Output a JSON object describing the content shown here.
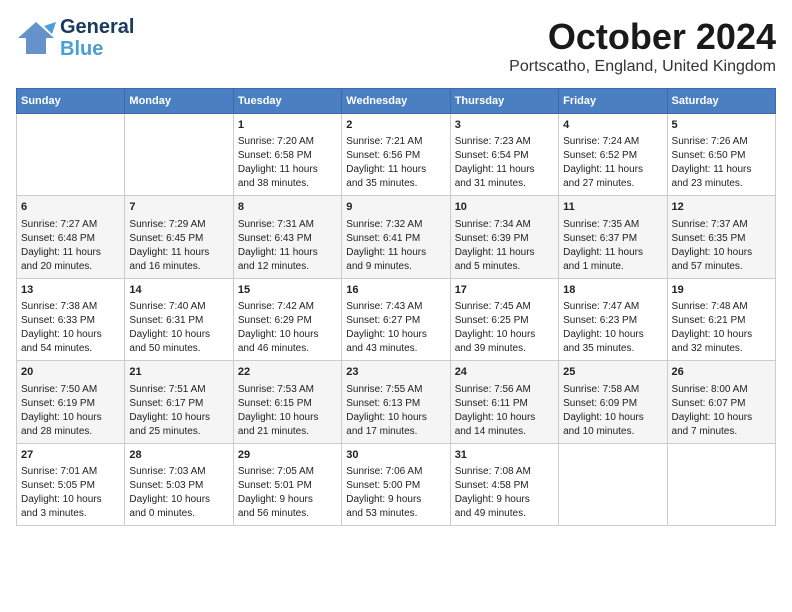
{
  "logo": {
    "line1": "General",
    "line2": "Blue"
  },
  "title": "October 2024",
  "location": "Portscatho, England, United Kingdom",
  "days_of_week": [
    "Sunday",
    "Monday",
    "Tuesday",
    "Wednesday",
    "Thursday",
    "Friday",
    "Saturday"
  ],
  "weeks": [
    [
      {
        "day": "",
        "content": ""
      },
      {
        "day": "",
        "content": ""
      },
      {
        "day": "1",
        "content": "Sunrise: 7:20 AM\nSunset: 6:58 PM\nDaylight: 11 hours\nand 38 minutes."
      },
      {
        "day": "2",
        "content": "Sunrise: 7:21 AM\nSunset: 6:56 PM\nDaylight: 11 hours\nand 35 minutes."
      },
      {
        "day": "3",
        "content": "Sunrise: 7:23 AM\nSunset: 6:54 PM\nDaylight: 11 hours\nand 31 minutes."
      },
      {
        "day": "4",
        "content": "Sunrise: 7:24 AM\nSunset: 6:52 PM\nDaylight: 11 hours\nand 27 minutes."
      },
      {
        "day": "5",
        "content": "Sunrise: 7:26 AM\nSunset: 6:50 PM\nDaylight: 11 hours\nand 23 minutes."
      }
    ],
    [
      {
        "day": "6",
        "content": "Sunrise: 7:27 AM\nSunset: 6:48 PM\nDaylight: 11 hours\nand 20 minutes."
      },
      {
        "day": "7",
        "content": "Sunrise: 7:29 AM\nSunset: 6:45 PM\nDaylight: 11 hours\nand 16 minutes."
      },
      {
        "day": "8",
        "content": "Sunrise: 7:31 AM\nSunset: 6:43 PM\nDaylight: 11 hours\nand 12 minutes."
      },
      {
        "day": "9",
        "content": "Sunrise: 7:32 AM\nSunset: 6:41 PM\nDaylight: 11 hours\nand 9 minutes."
      },
      {
        "day": "10",
        "content": "Sunrise: 7:34 AM\nSunset: 6:39 PM\nDaylight: 11 hours\nand 5 minutes."
      },
      {
        "day": "11",
        "content": "Sunrise: 7:35 AM\nSunset: 6:37 PM\nDaylight: 11 hours\nand 1 minute."
      },
      {
        "day": "12",
        "content": "Sunrise: 7:37 AM\nSunset: 6:35 PM\nDaylight: 10 hours\nand 57 minutes."
      }
    ],
    [
      {
        "day": "13",
        "content": "Sunrise: 7:38 AM\nSunset: 6:33 PM\nDaylight: 10 hours\nand 54 minutes."
      },
      {
        "day": "14",
        "content": "Sunrise: 7:40 AM\nSunset: 6:31 PM\nDaylight: 10 hours\nand 50 minutes."
      },
      {
        "day": "15",
        "content": "Sunrise: 7:42 AM\nSunset: 6:29 PM\nDaylight: 10 hours\nand 46 minutes."
      },
      {
        "day": "16",
        "content": "Sunrise: 7:43 AM\nSunset: 6:27 PM\nDaylight: 10 hours\nand 43 minutes."
      },
      {
        "day": "17",
        "content": "Sunrise: 7:45 AM\nSunset: 6:25 PM\nDaylight: 10 hours\nand 39 minutes."
      },
      {
        "day": "18",
        "content": "Sunrise: 7:47 AM\nSunset: 6:23 PM\nDaylight: 10 hours\nand 35 minutes."
      },
      {
        "day": "19",
        "content": "Sunrise: 7:48 AM\nSunset: 6:21 PM\nDaylight: 10 hours\nand 32 minutes."
      }
    ],
    [
      {
        "day": "20",
        "content": "Sunrise: 7:50 AM\nSunset: 6:19 PM\nDaylight: 10 hours\nand 28 minutes."
      },
      {
        "day": "21",
        "content": "Sunrise: 7:51 AM\nSunset: 6:17 PM\nDaylight: 10 hours\nand 25 minutes."
      },
      {
        "day": "22",
        "content": "Sunrise: 7:53 AM\nSunset: 6:15 PM\nDaylight: 10 hours\nand 21 minutes."
      },
      {
        "day": "23",
        "content": "Sunrise: 7:55 AM\nSunset: 6:13 PM\nDaylight: 10 hours\nand 17 minutes."
      },
      {
        "day": "24",
        "content": "Sunrise: 7:56 AM\nSunset: 6:11 PM\nDaylight: 10 hours\nand 14 minutes."
      },
      {
        "day": "25",
        "content": "Sunrise: 7:58 AM\nSunset: 6:09 PM\nDaylight: 10 hours\nand 10 minutes."
      },
      {
        "day": "26",
        "content": "Sunrise: 8:00 AM\nSunset: 6:07 PM\nDaylight: 10 hours\nand 7 minutes."
      }
    ],
    [
      {
        "day": "27",
        "content": "Sunrise: 7:01 AM\nSunset: 5:05 PM\nDaylight: 10 hours\nand 3 minutes."
      },
      {
        "day": "28",
        "content": "Sunrise: 7:03 AM\nSunset: 5:03 PM\nDaylight: 10 hours\nand 0 minutes."
      },
      {
        "day": "29",
        "content": "Sunrise: 7:05 AM\nSunset: 5:01 PM\nDaylight: 9 hours\nand 56 minutes."
      },
      {
        "day": "30",
        "content": "Sunrise: 7:06 AM\nSunset: 5:00 PM\nDaylight: 9 hours\nand 53 minutes."
      },
      {
        "day": "31",
        "content": "Sunrise: 7:08 AM\nSunset: 4:58 PM\nDaylight: 9 hours\nand 49 minutes."
      },
      {
        "day": "",
        "content": ""
      },
      {
        "day": "",
        "content": ""
      }
    ]
  ]
}
